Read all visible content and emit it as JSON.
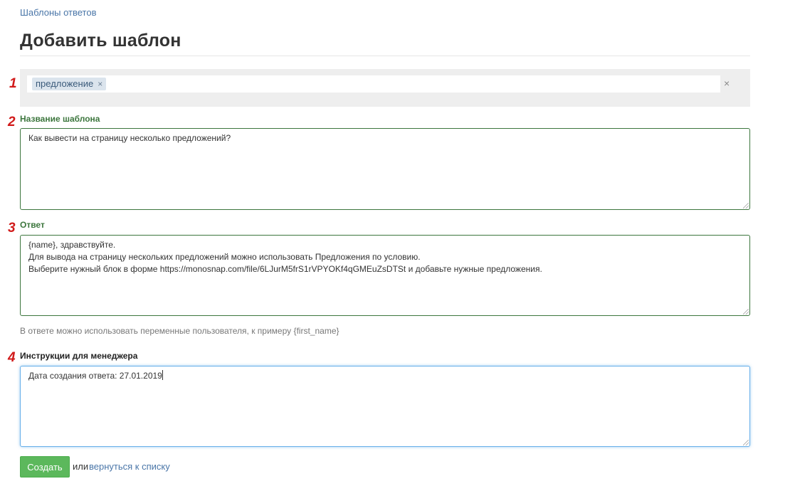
{
  "breadcrumb": "Шаблоны ответов",
  "page_title": "Добавить шаблон",
  "markers": [
    "1",
    "2",
    "3",
    "4"
  ],
  "tags": {
    "items": [
      {
        "label": "предложение",
        "remove": "×"
      }
    ],
    "clear": "×"
  },
  "template_name": {
    "label": "Название шаблона",
    "value": "Как вывести на страницу несколько предложений?"
  },
  "answer": {
    "label": "Ответ",
    "value": "{name}, здравствуйте.\nДля вывода на страницу нескольких предложений можно использовать Предложения по условию.\nВыберите нужный блок в форме https://monosnap.com/file/6LJurM5frS1rVPYOKf4qGMEuZsDTSt и добавьте нужные предложения.",
    "help": "В ответе можно использовать переменные пользователя, к примеру {first_name}"
  },
  "manager_instructions": {
    "label": "Инструкции для менеджера",
    "value": "Дата создания ответа: 27.01.2019"
  },
  "actions": {
    "submit": "Создать",
    "or": "или",
    "back": "вернуться к списку"
  },
  "colors": {
    "link": "#4a76a8",
    "success_label": "#3c763d",
    "button_green": "#5cb85c",
    "marker_red": "#d11a1a",
    "focus_blue": "#66afe9"
  }
}
